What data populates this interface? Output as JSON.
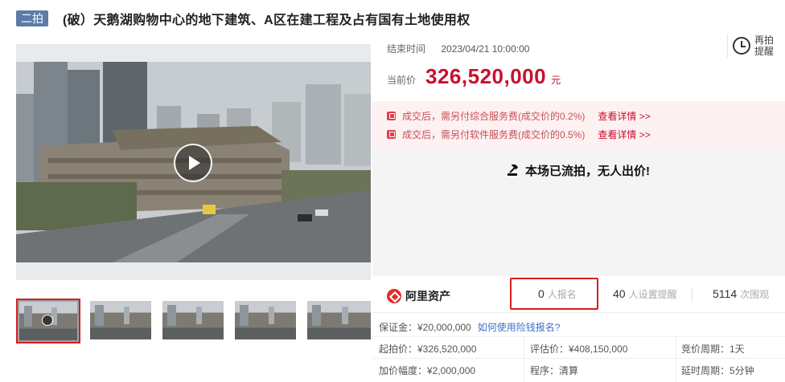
{
  "header": {
    "round_badge": "二拍",
    "title": "(破）天鹅湖购物中心的地下建筑、A区在建工程及占有国有土地使用权"
  },
  "gallery": {
    "thumbnail_count": 5,
    "active_index": 0
  },
  "auction": {
    "end_label": "结束时间",
    "end_value": "2023/04/21 10:00:00",
    "remind_line1": "再拍",
    "remind_line2": "提醒",
    "price_label": "当前价",
    "price_value": "326,520,000",
    "price_unit": "元",
    "fee_1": "成交后，需另付综合服务费(成交价的0.2%)",
    "fee_2": "成交后，需另付软件服务费(成交价的0.5%)",
    "fee_link": "查看详情 >>",
    "status": "本场已流拍，无人出价!"
  },
  "stats": {
    "brand": "阿里资产",
    "registered_count": "0",
    "registered_label": "人报名",
    "reminders_count": "40",
    "reminders_label": "人设置提醒",
    "views_count": "5114",
    "views_label": "次围观"
  },
  "details": {
    "deposit": "保证金：¥20,000,000",
    "deposit_link": "如何使用险钱报名?",
    "start_price": "起拍价：¥326,520,000",
    "assessed_price": "评估价：¥408,150,000",
    "bid_period": "竞价周期：1天",
    "increment": "加价幅度：¥2,000,000",
    "procedure": "程序：清算",
    "delay_period": "延时周期：5分钟"
  },
  "colors": {
    "accent_red": "#c8102e",
    "badge_blue": "#5b7ba8",
    "link_blue": "#3d6ec9",
    "highlight_border": "#d81e1e"
  }
}
